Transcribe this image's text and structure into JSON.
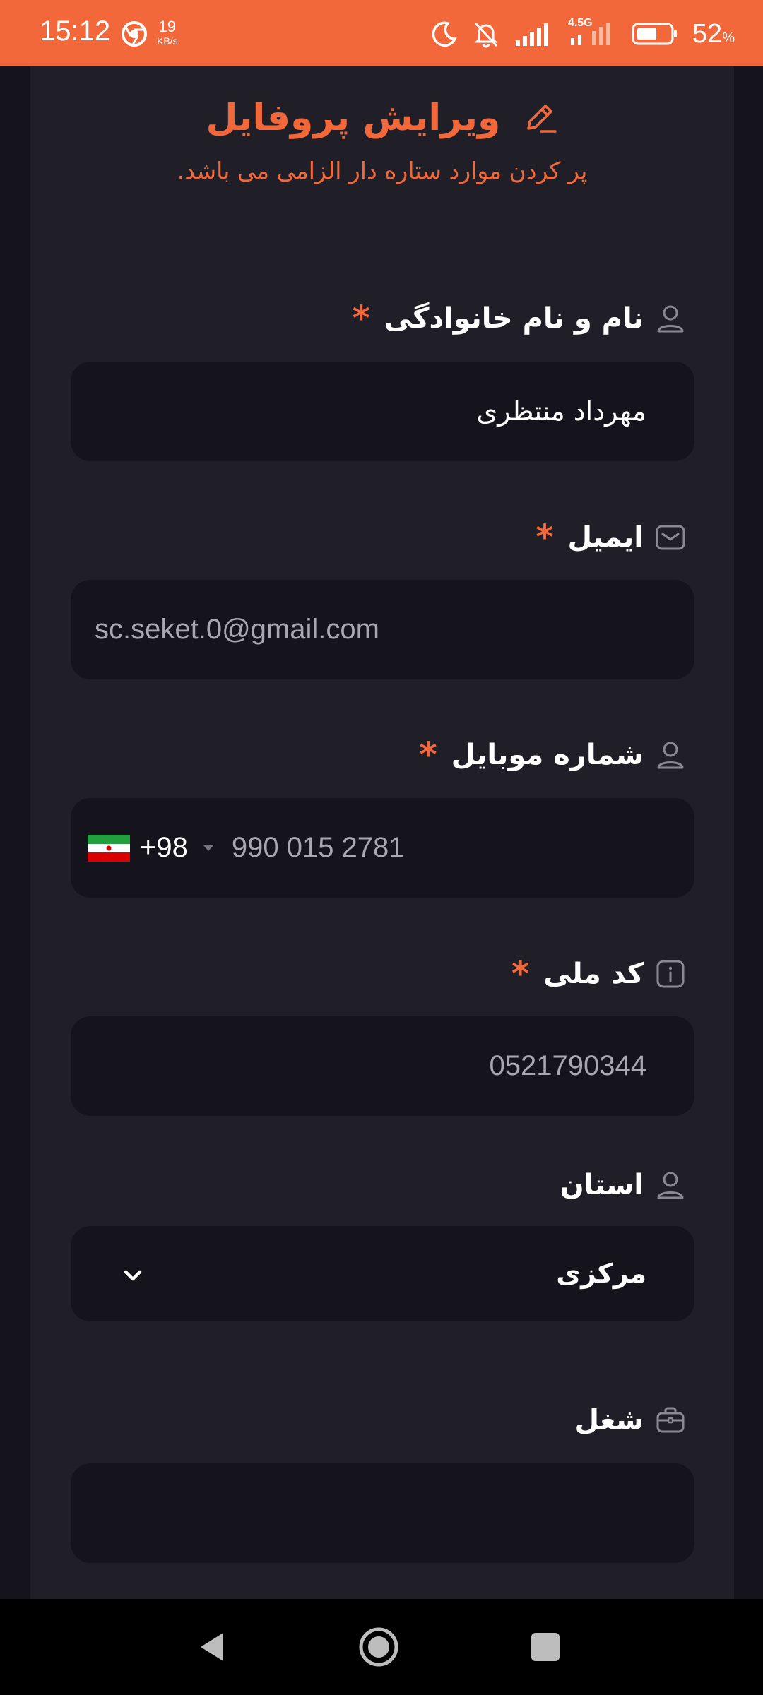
{
  "status_bar": {
    "time": "15:12",
    "net_speed_value": "19",
    "net_speed_unit": "KB/s",
    "network_type": "4.5G",
    "battery_percent": "52",
    "battery_symbol": "%",
    "battery_level": 0.52
  },
  "header": {
    "title": "ویرایش پروفایل",
    "subtitle": "پر کردن موارد ستاره دار الزامی می باشد.",
    "title_color": "#f2683a"
  },
  "form": {
    "full_name": {
      "label": "نام و نام خانوادگی",
      "required_mark": "*",
      "value": "مهرداد منتظری",
      "icon": "user-icon"
    },
    "email": {
      "label": "ایمیل",
      "required_mark": "*",
      "value": "sc.seket.0@gmail.com",
      "icon": "mail-icon"
    },
    "mobile": {
      "label": "شماره موبایل",
      "required_mark": "*",
      "country_code": "+98",
      "value": "990 015 2781",
      "icon": "user-icon"
    },
    "national_code": {
      "label": "کد ملی",
      "required_mark": "*",
      "value": "0521790344",
      "icon": "info-icon"
    },
    "province": {
      "label": "استان",
      "value": "مرکزی",
      "icon": "user-icon"
    },
    "job": {
      "label": "شغل",
      "value": "",
      "icon": "briefcase-icon"
    }
  },
  "colors": {
    "accent": "#f2683a",
    "panel_bg": "#201f28",
    "input_bg": "#15141c"
  }
}
